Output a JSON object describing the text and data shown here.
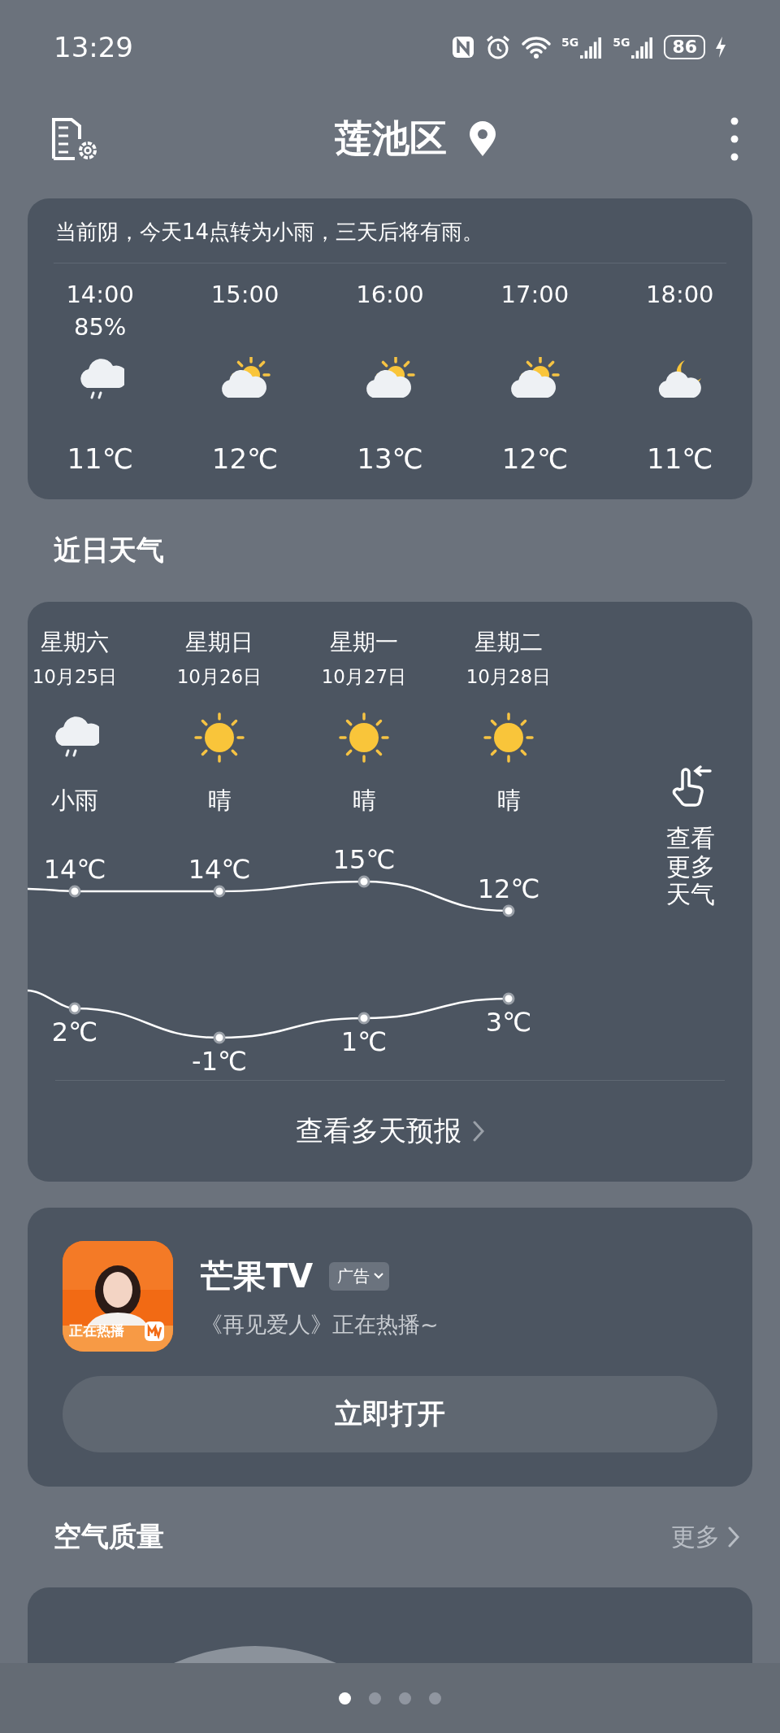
{
  "status_bar": {
    "time": "13:29",
    "network_labels": [
      "5G",
      "5G"
    ],
    "battery": "86",
    "charging": true
  },
  "header": {
    "location": "莲池区"
  },
  "hourly": {
    "summary": "当前阴，今天14点转为小雨，三天后将有雨。",
    "hours": [
      {
        "time": "14:00",
        "precip": "85%",
        "kind": "rain",
        "temp": "11℃"
      },
      {
        "time": "15:00",
        "kind": "partly-sunny",
        "temp": "12℃"
      },
      {
        "time": "16:00",
        "kind": "partly-sunny",
        "temp": "13℃"
      },
      {
        "time": "17:00",
        "kind": "partly-sunny",
        "temp": "12℃"
      },
      {
        "time": "18:00",
        "kind": "night-cloudy",
        "temp": "11℃"
      }
    ]
  },
  "daily": {
    "title": "近日天气",
    "days": [
      {
        "weekday": "星期六",
        "date": "10月25日",
        "kind": "rain",
        "condition": "小雨",
        "high": "14℃",
        "low": "2℃"
      },
      {
        "weekday": "星期日",
        "date": "10月26日",
        "kind": "sunny",
        "condition": "晴",
        "high": "14℃",
        "low": "-1℃"
      },
      {
        "weekday": "星期一",
        "date": "10月27日",
        "kind": "sunny",
        "condition": "晴",
        "high": "15℃",
        "low": "1℃"
      },
      {
        "weekday": "星期二",
        "date": "10月28日",
        "kind": "sunny",
        "condition": "晴",
        "high": "12℃",
        "low": "3℃"
      }
    ],
    "more": "查看更多天气",
    "forecast_link": "查看多天预报"
  },
  "ad": {
    "app_name": "芒果TV",
    "tag": "广告",
    "subtitle": "《再见爱人》正在热播~",
    "icon_banner": "正在热播",
    "button": "立即打开"
  },
  "air_quality": {
    "title": "空气质量",
    "more": "更多"
  },
  "pages": [
    {
      "selected": true
    },
    {
      "selected": false
    },
    {
      "selected": false
    },
    {
      "selected": false
    }
  ]
}
